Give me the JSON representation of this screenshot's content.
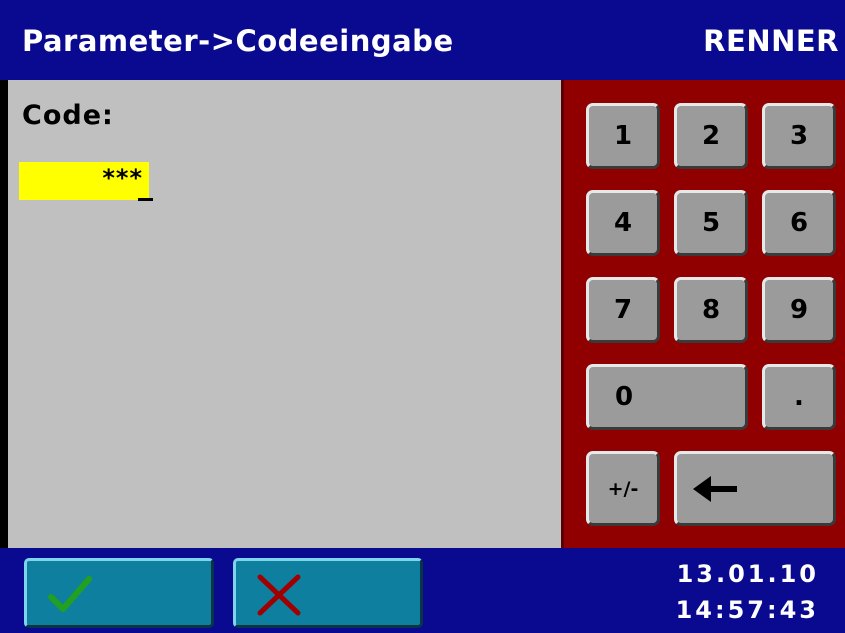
{
  "header": {
    "title": "Parameter->Codeeingabe",
    "brand": "RENNER"
  },
  "content": {
    "code_label": "Code:",
    "code_value": "***"
  },
  "keypad": {
    "keys": [
      "1",
      "2",
      "3",
      "4",
      "5",
      "6",
      "7",
      "8",
      "9",
      "0",
      ".",
      "+/-"
    ],
    "backspace_icon": "left-arrow-icon"
  },
  "footer": {
    "ok_icon": "checkmark-icon",
    "cancel_icon": "x-cross-icon",
    "date": "13.01.10",
    "time": "14:57:43"
  },
  "colors": {
    "header_bg": "#0a0a90",
    "content_bg": "#c0c0c0",
    "keypad_bg": "#900000",
    "input_highlight": "#ffff00",
    "button_teal": "#0e7f9e",
    "check_green": "#22a022",
    "cross_red": "#a00000"
  }
}
